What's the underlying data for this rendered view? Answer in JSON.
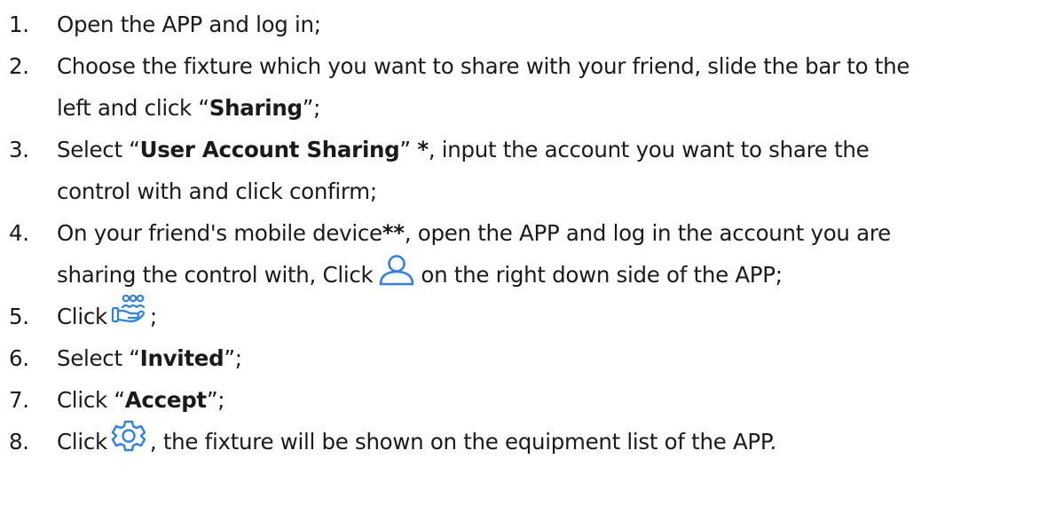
{
  "steps": [
    {
      "number": "1.",
      "lines": [
        {
          "parts": [
            {
              "text": "Open the APP and log in;"
            }
          ]
        }
      ]
    },
    {
      "number": "2.",
      "lines": [
        {
          "parts": [
            {
              "text": "Choose the fixture which you want to share with your friend, slide the bar to the"
            }
          ]
        },
        {
          "parts": [
            {
              "text": "left and click “"
            },
            {
              "text": "Sharing",
              "bold": true
            },
            {
              "text": "”;"
            }
          ]
        }
      ]
    },
    {
      "number": "3.",
      "lines": [
        {
          "parts": [
            {
              "text": "Select “"
            },
            {
              "text": "User Account Sharing",
              "bold": true
            },
            {
              "text": "” "
            },
            {
              "text": "*",
              "bold": true
            },
            {
              "text": ", input the account you want to share the"
            }
          ]
        },
        {
          "parts": [
            {
              "text": "control with and click confirm;"
            }
          ]
        }
      ]
    },
    {
      "number": "4.",
      "lines": [
        {
          "parts": [
            {
              "text": "On your friend's mobile device"
            },
            {
              "text": "**",
              "bold": true
            },
            {
              "text": ", open the APP and log in the account you are"
            }
          ]
        },
        {
          "parts": [
            {
              "text": "sharing the control with, Click"
            },
            {
              "icon": "person-icon"
            },
            {
              "text": "on the right down side of the APP;"
            }
          ]
        }
      ]
    },
    {
      "number": "5.",
      "lines": [
        {
          "parts": [
            {
              "text": "Click"
            },
            {
              "icon": "share-icon"
            },
            {
              "text": ";"
            }
          ]
        }
      ]
    },
    {
      "number": "6.",
      "lines": [
        {
          "parts": [
            {
              "text": "Select “"
            },
            {
              "text": "Invited",
              "bold": true
            },
            {
              "text": "”;"
            }
          ]
        }
      ]
    },
    {
      "number": "7.",
      "lines": [
        {
          "parts": [
            {
              "text": "Click “"
            },
            {
              "text": "Accept",
              "bold": true
            },
            {
              "text": "”;"
            }
          ]
        }
      ]
    },
    {
      "number": "8.",
      "lines": [
        {
          "parts": [
            {
              "text": "Click"
            },
            {
              "icon": "gear-icon"
            },
            {
              "text": ", the fixture will be shown on the equipment list of the APP."
            }
          ]
        }
      ]
    }
  ],
  "icon_color": "#2f80ed"
}
